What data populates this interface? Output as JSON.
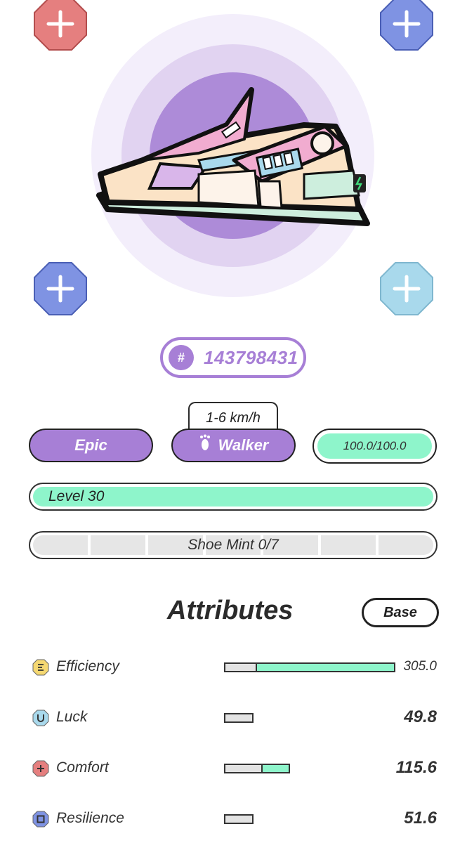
{
  "sockets": [
    {
      "id": "top-left",
      "color": "#e57f7f",
      "icon": "plus-icon"
    },
    {
      "id": "top-right",
      "color": "#7f93e3",
      "icon": "plus-icon"
    },
    {
      "id": "bottom-left",
      "color": "#7f93e3",
      "icon": "plus-icon"
    },
    {
      "id": "bottom-right",
      "color": "#a9d9ec",
      "icon": "plus-icon"
    }
  ],
  "sneaker": {
    "id_symbol": "#",
    "id_number": "143798431",
    "accent": "#a77fd6"
  },
  "speed_range": "1-6 km/h",
  "rarity": "Epic",
  "type": {
    "label": "Walker",
    "icon": "footprint-icon"
  },
  "durability": "100.0/100.0",
  "level": {
    "label": "Level 30",
    "progress": 1.0
  },
  "mint": {
    "label": "Shoe Mint 0/7",
    "used": 0,
    "total": 7
  },
  "attributes": {
    "title": "Attributes",
    "toggle": "Base",
    "items": [
      {
        "name": "Efficiency",
        "value": "305.0",
        "icon": "efficiency-icon",
        "color": "#f5d872",
        "base_fraction": 0.18,
        "bonus_fraction": 0.82
      },
      {
        "name": "Luck",
        "value": "49.8",
        "icon": "luck-icon",
        "color": "#a9d9ec",
        "base_fraction": 1.0,
        "bonus_fraction": 0
      },
      {
        "name": "Comfort",
        "value": "115.6",
        "icon": "comfort-icon",
        "color": "#e57f7f",
        "base_fraction": 0.57,
        "bonus_fraction": 0.43
      },
      {
        "name": "Resilience",
        "value": "51.6",
        "icon": "resilience-icon",
        "color": "#7f93e3",
        "base_fraction": 1.0,
        "bonus_fraction": 0
      }
    ]
  }
}
